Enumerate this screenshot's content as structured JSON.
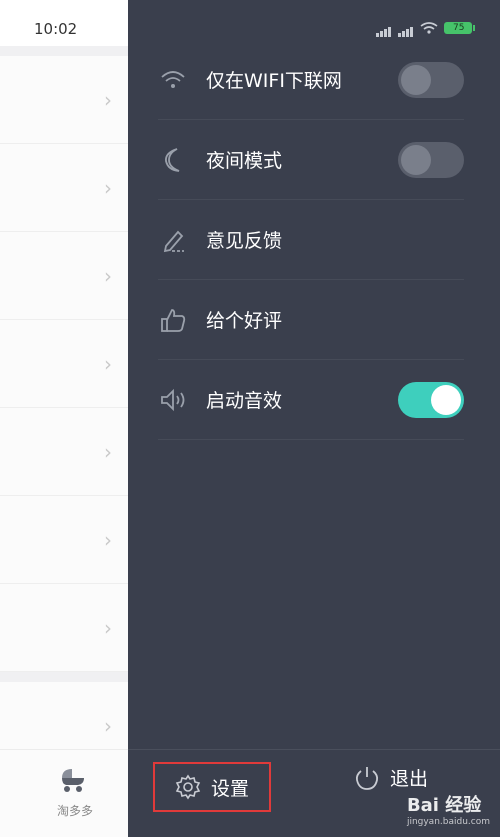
{
  "status": {
    "time": "10:02",
    "battery": "75"
  },
  "drawer": {
    "items": [
      {
        "label": "仅在WIFI下联网",
        "icon": "wifi-icon",
        "toggle": false
      },
      {
        "label": "夜间模式",
        "icon": "moon-icon",
        "toggle": false
      },
      {
        "label": "意见反馈",
        "icon": "pen-icon"
      },
      {
        "label": "给个好评",
        "icon": "thumbs-up-icon"
      },
      {
        "label": "启动音效",
        "icon": "speaker-icon",
        "toggle": true
      }
    ],
    "bottom": {
      "settings_label": "设置",
      "logout_label": "退出"
    }
  },
  "background": {
    "app_label": "淘多多",
    "chevron": "›"
  },
  "watermark": {
    "brand": "Bai 经验",
    "url": "jingyan.baidu.com"
  },
  "colors": {
    "drawer_bg": "#3a3f4d",
    "toggle_on": "#3ecfbd",
    "highlight": "#e03a3a"
  }
}
